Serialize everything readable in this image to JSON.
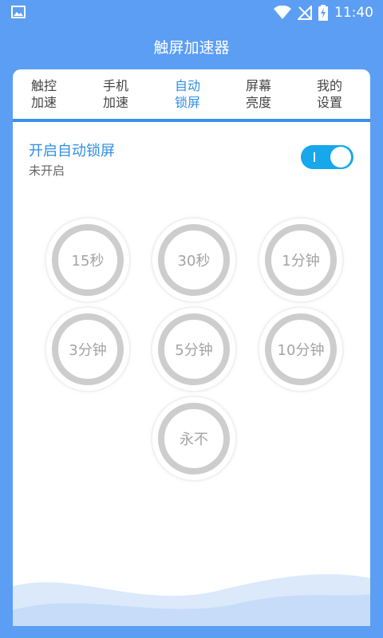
{
  "status": {
    "time": "11:40"
  },
  "app": {
    "title": "触屏加速器"
  },
  "tabs": [
    {
      "line1": "触控",
      "line2": "加速"
    },
    {
      "line1": "手机",
      "line2": "加速"
    },
    {
      "line1": "自动",
      "line2": "锁屏"
    },
    {
      "line1": "屏幕",
      "line2": "亮度"
    },
    {
      "line1": "我的",
      "line2": "设置"
    }
  ],
  "active_tab_index": 2,
  "autolock": {
    "title": "开启自动锁屏",
    "status": "未开启",
    "switch_on": true,
    "switch_symbol": "I"
  },
  "timeouts": [
    "15秒",
    "30秒",
    "1分钟",
    "3分钟",
    "5分钟",
    "10分钟",
    "永不"
  ],
  "colors": {
    "background": "#5b9ef4",
    "accent": "#2f8ee5",
    "switch": "#17a7ea",
    "ring": "#cdcdcd"
  },
  "icons": [
    "image-icon",
    "wifi-icon",
    "no-signal-icon",
    "battery-charging-icon"
  ]
}
